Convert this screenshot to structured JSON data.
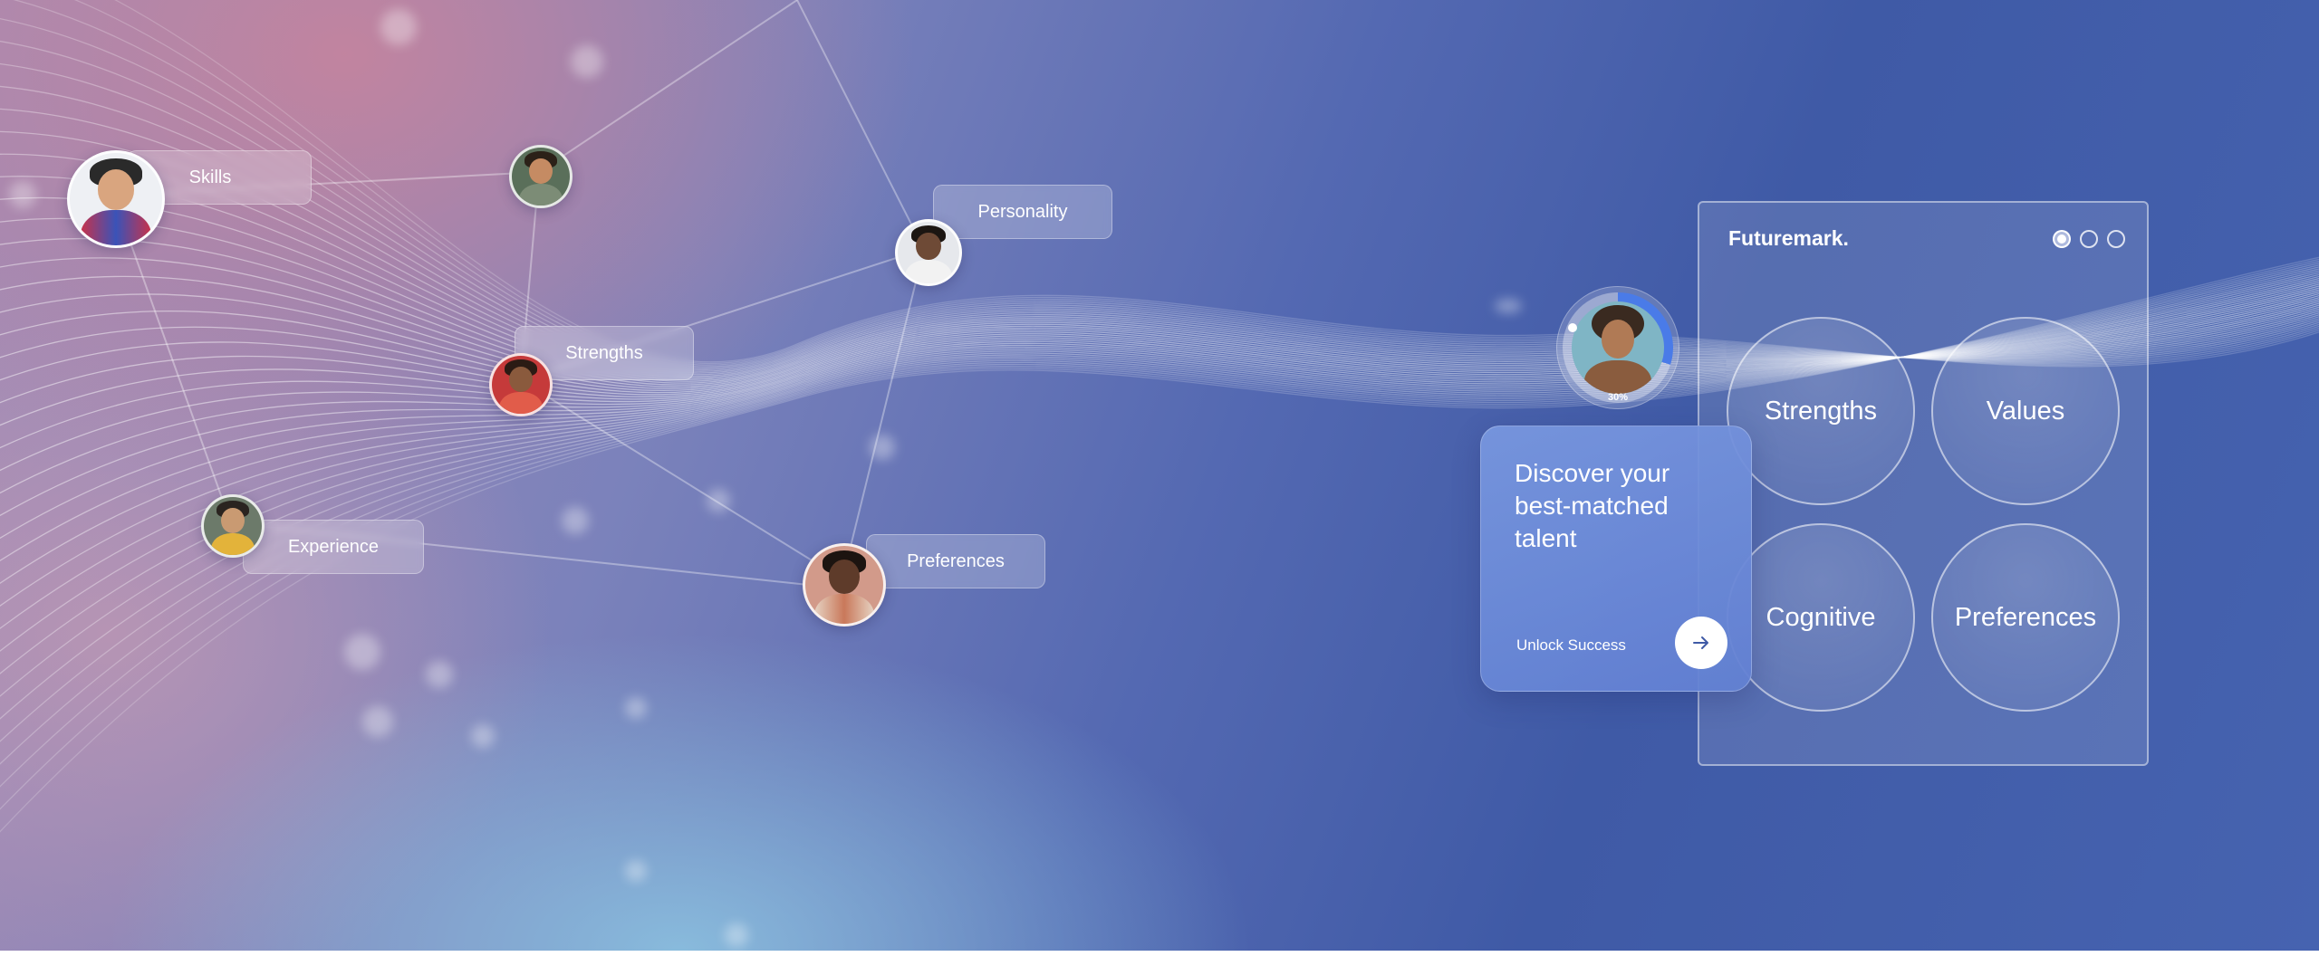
{
  "tags": {
    "skills": "Skills",
    "strengths": "Strengths",
    "experience": "Experience",
    "personality": "Personality",
    "preferences": "Preferences"
  },
  "card": {
    "brand": "Futuremark.",
    "pagination_active": 1,
    "pagination_total": 3,
    "categories": [
      "Strengths",
      "Values",
      "Cognitive",
      "Preferences"
    ]
  },
  "discover": {
    "headline": "Discover your best-matched talent",
    "cta_label": "Unlock Success"
  },
  "profile": {
    "progress_label": "30%",
    "progress": 0.3
  },
  "colors": {
    "accent": "#4a7be8",
    "background_blue": "#3f5aa6",
    "background_pink": "#c4849e"
  }
}
